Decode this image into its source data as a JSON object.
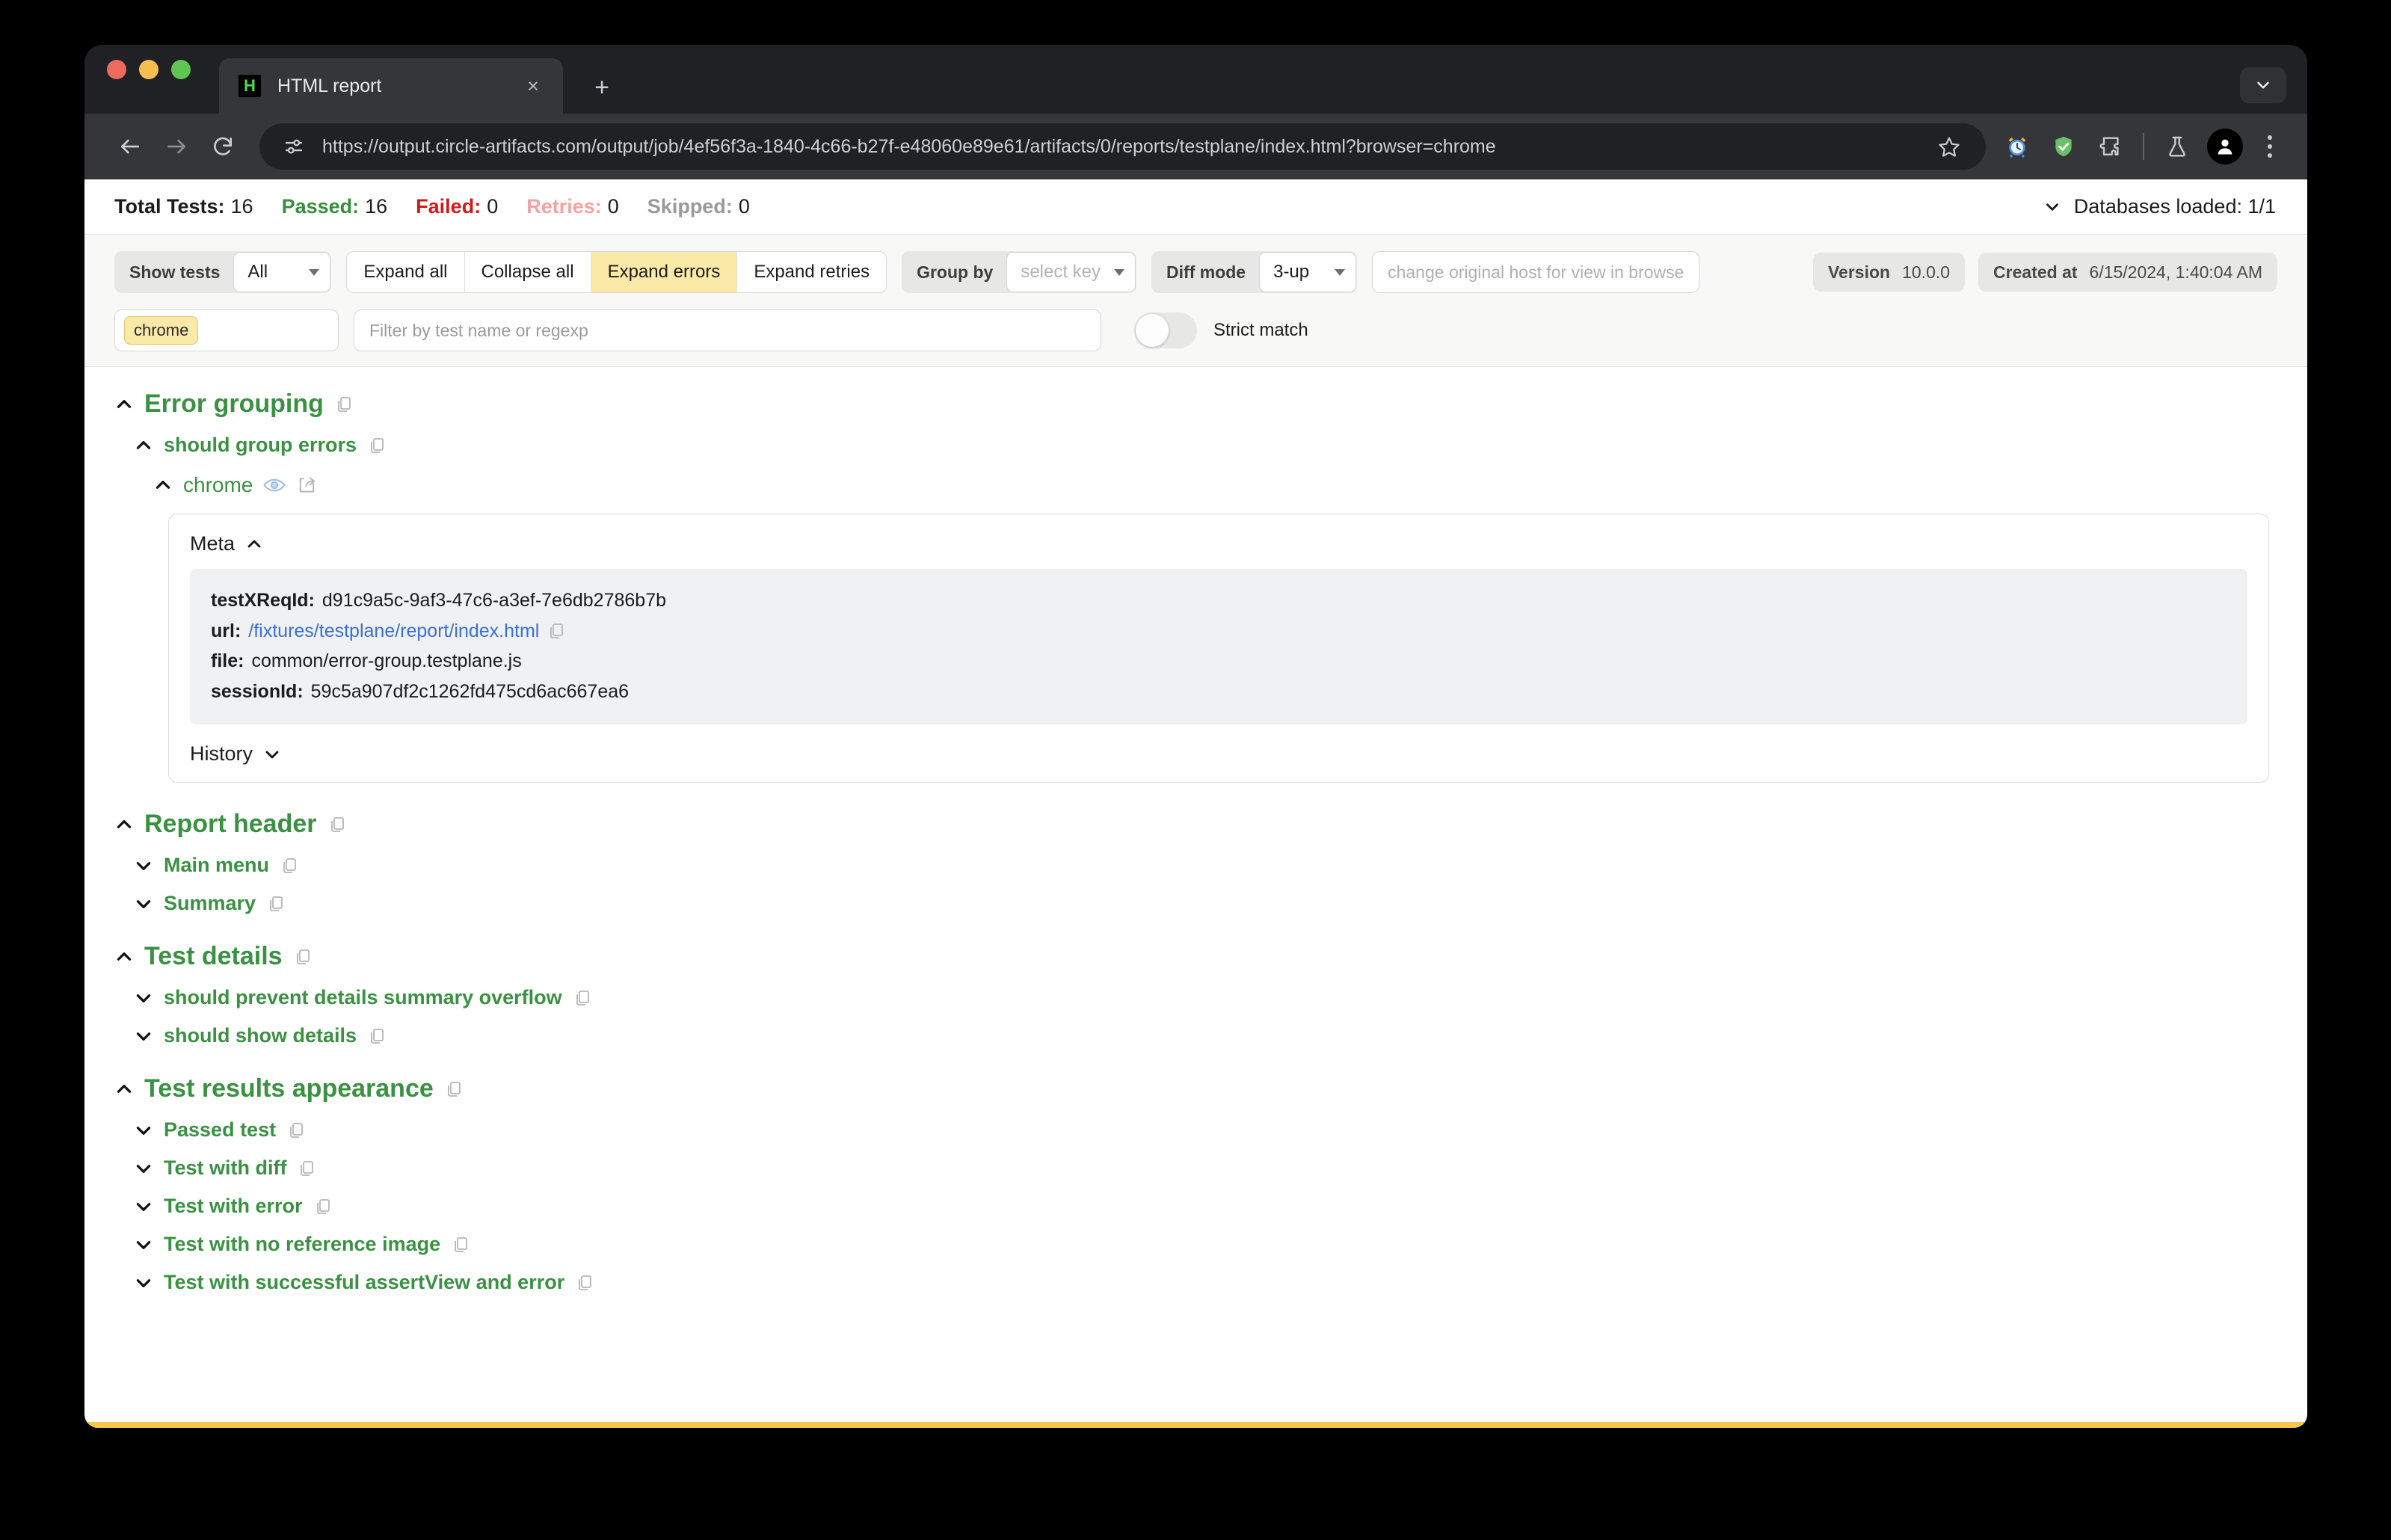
{
  "browser": {
    "tab": {
      "title": "HTML report",
      "favicon_letter": "H"
    },
    "new_tab_label": "+",
    "close_label": "×",
    "url": "https://output.circle-artifacts.com/output/job/4ef56f3a-1840-4c66-b27f-e48060e89e61/artifacts/0/reports/testplane/index.html?browser=chrome",
    "toolbar_icons": [
      "back-arrow",
      "forward-arrow",
      "reload",
      "site-settings",
      "bookmark-star",
      "alarm-clock-extension",
      "shield-extension",
      "extensions-puzzle",
      "labs-flask",
      "profile-avatar",
      "menu-kebab"
    ]
  },
  "summary": {
    "items": [
      {
        "label": "Total Tests:",
        "value": "16",
        "kind": "total"
      },
      {
        "label": "Passed:",
        "value": "16",
        "kind": "passed"
      },
      {
        "label": "Failed:",
        "value": "0",
        "kind": "failed"
      },
      {
        "label": "Retries:",
        "value": "0",
        "kind": "retries"
      },
      {
        "label": "Skipped:",
        "value": "0",
        "kind": "skipped"
      }
    ],
    "databases_loaded": "Databases loaded: 1/1"
  },
  "controls": {
    "show_tests_label": "Show tests",
    "show_tests_value": "All",
    "buttons": [
      {
        "label": "Expand all",
        "active": false
      },
      {
        "label": "Collapse all",
        "active": false
      },
      {
        "label": "Expand errors",
        "active": true
      },
      {
        "label": "Expand retries",
        "active": false
      }
    ],
    "group_by_label": "Group by",
    "group_by_placeholder": "select key",
    "diff_mode_label": "Diff mode",
    "diff_mode_value": "3-up",
    "host_placeholder": "change original host for view in browse",
    "version_label": "Version",
    "version_value": "10.0.0",
    "created_at_label": "Created at",
    "created_at_value": "6/15/2024, 1:40:04 AM",
    "browser_tag": "chrome",
    "filter_placeholder": "Filter by test name or regexp",
    "strict_match_label": "Strict match",
    "strict_match_on": false
  },
  "tree": [
    {
      "title": "Error grouping",
      "expanded": true,
      "tests": [
        {
          "title": "should group errors",
          "expanded": true,
          "browsers": [
            {
              "name": "chrome",
              "expanded": true,
              "meta_section": "Meta",
              "meta": [
                {
                  "key": "testXReqId:",
                  "value": "d91c9a5c-9af3-47c6-a3ef-7e6db2786b7b",
                  "link": false,
                  "copy": false
                },
                {
                  "key": "url:",
                  "value": "/fixtures/testplane/report/index.html",
                  "link": true,
                  "copy": true
                },
                {
                  "key": "file:",
                  "value": "common/error-group.testplane.js",
                  "link": false,
                  "copy": false
                },
                {
                  "key": "sessionId:",
                  "value": "59c5a907df2c1262fd475cd6ac667ea6",
                  "link": false,
                  "copy": false
                }
              ],
              "history_section": "History"
            }
          ]
        }
      ]
    },
    {
      "title": "Report header",
      "expanded": true,
      "tests": [
        {
          "title": "Main menu",
          "expanded": false,
          "browsers": []
        },
        {
          "title": "Summary",
          "expanded": false,
          "browsers": []
        }
      ]
    },
    {
      "title": "Test details",
      "expanded": true,
      "tests": [
        {
          "title": "should prevent details summary overflow",
          "expanded": false,
          "browsers": []
        },
        {
          "title": "should show details",
          "expanded": false,
          "browsers": []
        }
      ]
    },
    {
      "title": "Test results appearance",
      "expanded": true,
      "tests": [
        {
          "title": "Passed test",
          "expanded": false,
          "browsers": []
        },
        {
          "title": "Test with diff",
          "expanded": false,
          "browsers": []
        },
        {
          "title": "Test with error",
          "expanded": false,
          "browsers": []
        },
        {
          "title": "Test with no reference image",
          "expanded": false,
          "browsers": []
        },
        {
          "title": "Test with successful assertView and error",
          "expanded": false,
          "browsers": []
        }
      ]
    }
  ],
  "colors": {
    "pass_green": "#3a9142",
    "fail_red": "#d11a1a",
    "highlight_yellow": "#fbe9a8",
    "window_accent": "#f5c84c",
    "link_blue": "#3b6fd4"
  }
}
